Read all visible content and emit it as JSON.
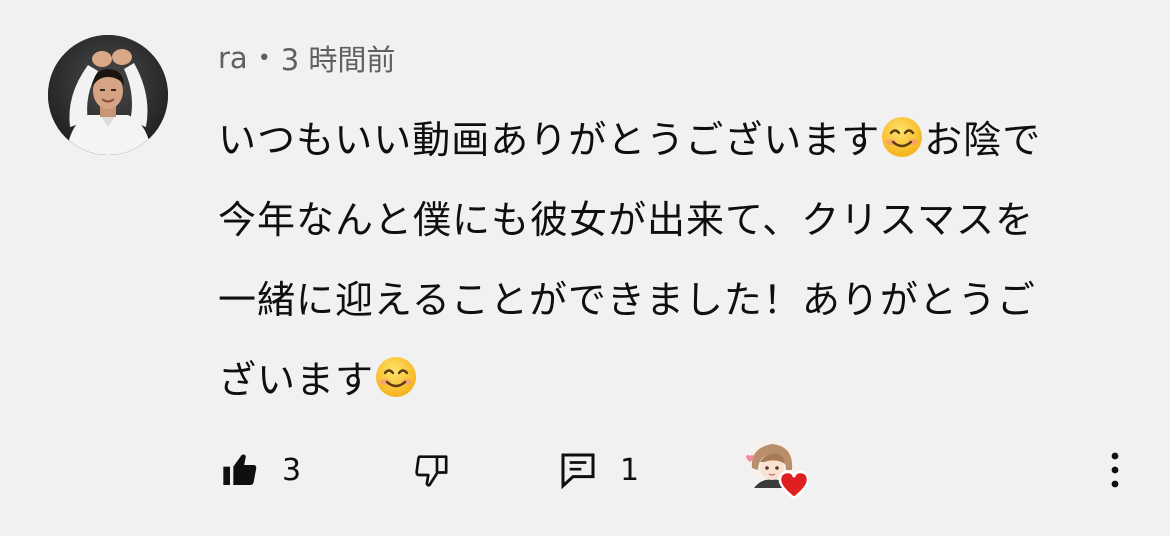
{
  "comment": {
    "author": "ra",
    "separator": "•",
    "time": "3 時間前",
    "lines": [
      "いつもいい動画ありがとうございます",
      "お陰で",
      "今年なんと僕にも彼女が出来て、クリスマスを",
      "一緒に迎えることができました！ありがとうご",
      "ざいます"
    ],
    "emoji": "smiling-face-with-smiling-eyes-icon"
  },
  "actions": {
    "like_count": "3",
    "reply_count": "1",
    "icons": {
      "like": "thumbs-up-icon",
      "dislike": "thumbs-down-icon",
      "reply": "comment-icon",
      "heart": "creator-heart-icon",
      "more": "more-vertical-icon"
    }
  },
  "colors": {
    "background": "#f1f1f1",
    "text": "#0f0f0f",
    "meta": "#606060",
    "heart": "#e02020"
  }
}
